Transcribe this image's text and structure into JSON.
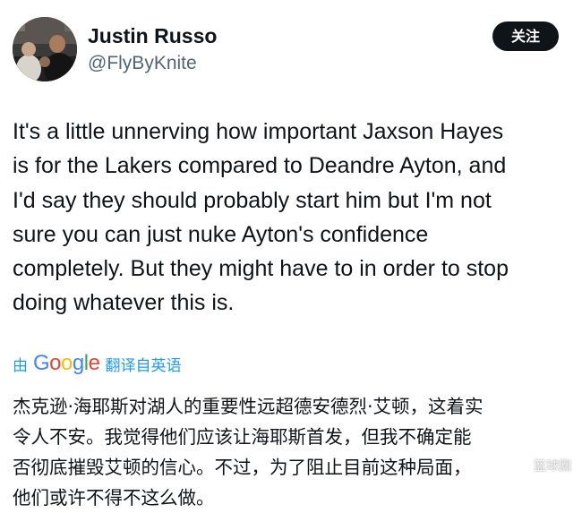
{
  "author": {
    "display_name": "Justin Russo",
    "handle": "@FlyByKnite",
    "avatar_icon": "user-avatar-photo"
  },
  "follow_button": {
    "label": "关注"
  },
  "tweet": {
    "lines": [
      "It's a little unnerving how important Jaxson Hayes",
      "is for the Lakers compared to Deandre Ayton, and",
      "I'd say they should probably start him but I'm not",
      "sure you can just nuke Ayton's confidence",
      "completely. But they might have to in order to stop",
      "doing whatever this is."
    ]
  },
  "translation_bar": {
    "prefix": "由",
    "brand_letters": [
      "G",
      "o",
      "o",
      "g",
      "l",
      "e"
    ],
    "brand_colors": [
      "#4285F4",
      "#EA4335",
      "#FBBC05",
      "#4285F4",
      "#34A853",
      "#EA4335"
    ],
    "suffix": "翻译自英语"
  },
  "translation": {
    "lines": [
      "杰克逊·海耶斯对湖人的重要性远超德安德烈·艾顿，这着实",
      "令人不安。我觉得他们应该让海耶斯首发，但我不确定能",
      "否彻底摧毁艾顿的信心。不过，为了阻止目前这种局面，",
      "他们或许不得不这么做。"
    ]
  },
  "watermark": {
    "text": "篮球圈"
  },
  "colors": {
    "text_primary": "#0f1419",
    "text_secondary": "#536471",
    "link_blue": "#1d9bf0",
    "button_bg": "#0f1419",
    "button_text": "#ffffff"
  }
}
